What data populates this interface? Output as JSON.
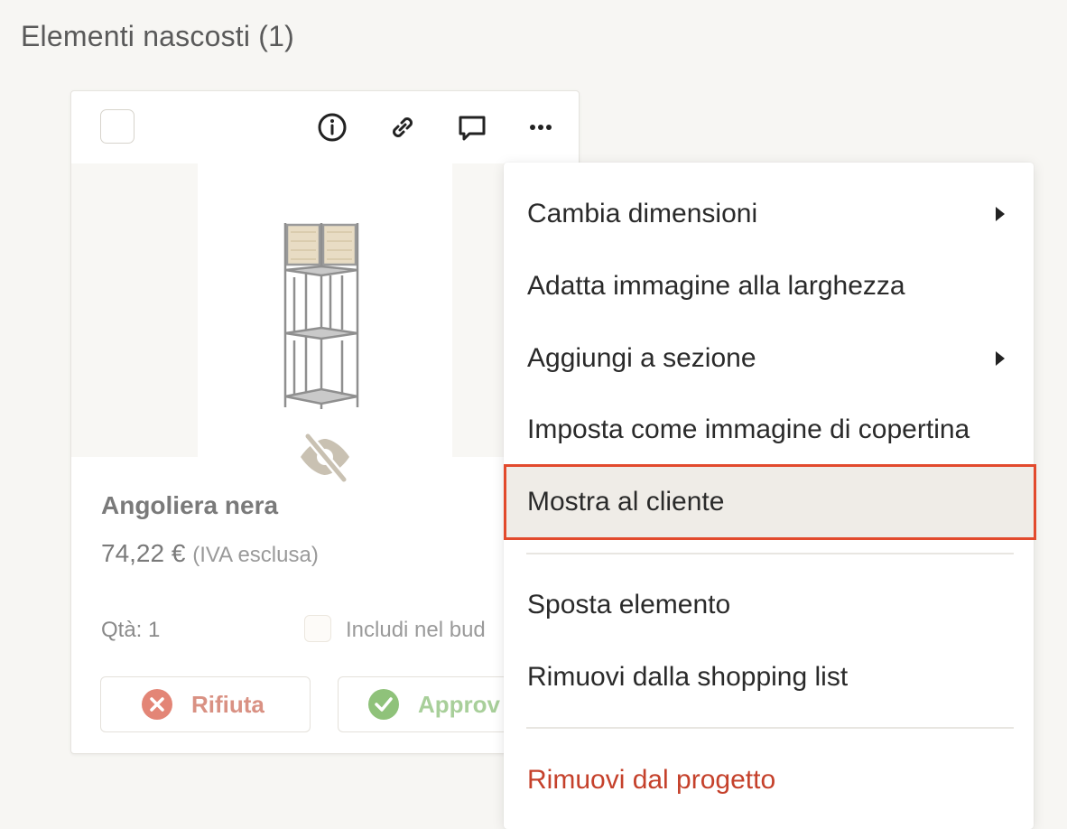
{
  "section": {
    "title": "Elementi nascosti (1)"
  },
  "toolbar": {
    "icons": [
      "info-icon",
      "link-icon",
      "comment-icon",
      "more-icon"
    ]
  },
  "product": {
    "name": "Angoliera nera",
    "price": "74,22 €",
    "vat_note": "(IVA esclusa)",
    "qty": "Qtà: 1",
    "include_label": "Includi nel bud",
    "hidden_icon": "eye-slash-icon"
  },
  "actions": {
    "reject_label": "Rifiuta",
    "approve_label": "Approv"
  },
  "menu": {
    "items": [
      {
        "label": "Cambia dimensioni",
        "has_submenu": true
      },
      {
        "label": "Adatta immagine alla larghezza"
      },
      {
        "label": "Aggiungi a sezione",
        "has_submenu": true
      },
      {
        "label": "Imposta come immagine di copertina"
      },
      {
        "label": "Mostra al cliente",
        "highlighted": true
      },
      {
        "label": "Sposta elemento"
      },
      {
        "label": "Rimuovi dalla shopping list"
      },
      {
        "label": "Rimuovi dal progetto",
        "danger": true
      }
    ]
  },
  "colors": {
    "highlight_outline": "#e24a2d",
    "danger_text": "#c5412b",
    "reject": "#e38576",
    "approve": "#8fc27a"
  }
}
